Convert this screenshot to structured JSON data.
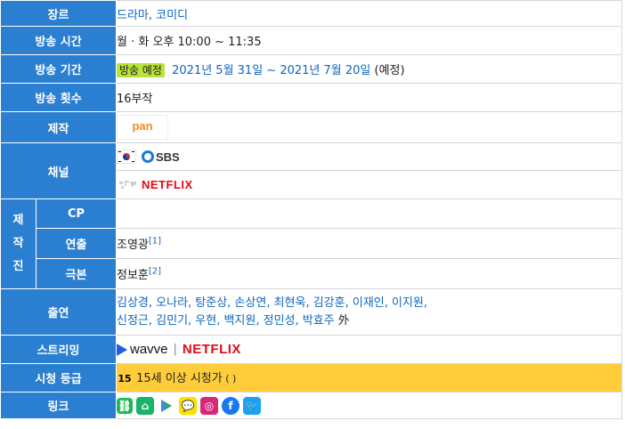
{
  "rows": {
    "genre": {
      "label": "장르",
      "value": "드라마, 코미디"
    },
    "airtime": {
      "label": "방송 시간",
      "value": "월 · 화 오후 10:00 ~ 11:35"
    },
    "period": {
      "label": "방송 기간",
      "badge": "방송 예정",
      "dates": "2021년 5월 31일 ~ 2021년 7월 20일",
      "note": " (예정)"
    },
    "episodes": {
      "label": "방송 횟수",
      "value": "16부작"
    },
    "production": {
      "label": "제작",
      "logo": "pan"
    },
    "channel": {
      "label": "채널",
      "sbs": "SBS",
      "netflix": "NETFLIX"
    },
    "staff": {
      "label_chars": [
        "제",
        "작",
        "진"
      ],
      "cp_label": "CP",
      "director_label": "연출",
      "director_value": "조영광",
      "director_ref": "[1]",
      "writer_label": "극본",
      "writer_value": "정보훈",
      "writer_ref": "[2]"
    },
    "cast": {
      "label": "출연",
      "line1": "김상경, 오나라, 탕준상, 손상연, 최현욱, 김강훈, 이재인, 이지원,",
      "line2": "신정근, 김민기, 우현, 백지원, 정민성, 박효주",
      "suffix": " 外"
    },
    "streaming": {
      "label": "스트리밍",
      "wavve": "wavve",
      "sep": "|",
      "netflix": "NETFLIX"
    },
    "rating": {
      "label": "시청 등급",
      "badge": "15",
      "value": "15세 이상 시청가",
      "extra": " ( )"
    },
    "links": {
      "label": "링크"
    }
  },
  "colors": {
    "header_bg": "#2b7fd1",
    "link": "#0b66c2",
    "badge": "#b9e33a",
    "rating_bg": "#ffcd3a",
    "netflix": "#e50914"
  }
}
